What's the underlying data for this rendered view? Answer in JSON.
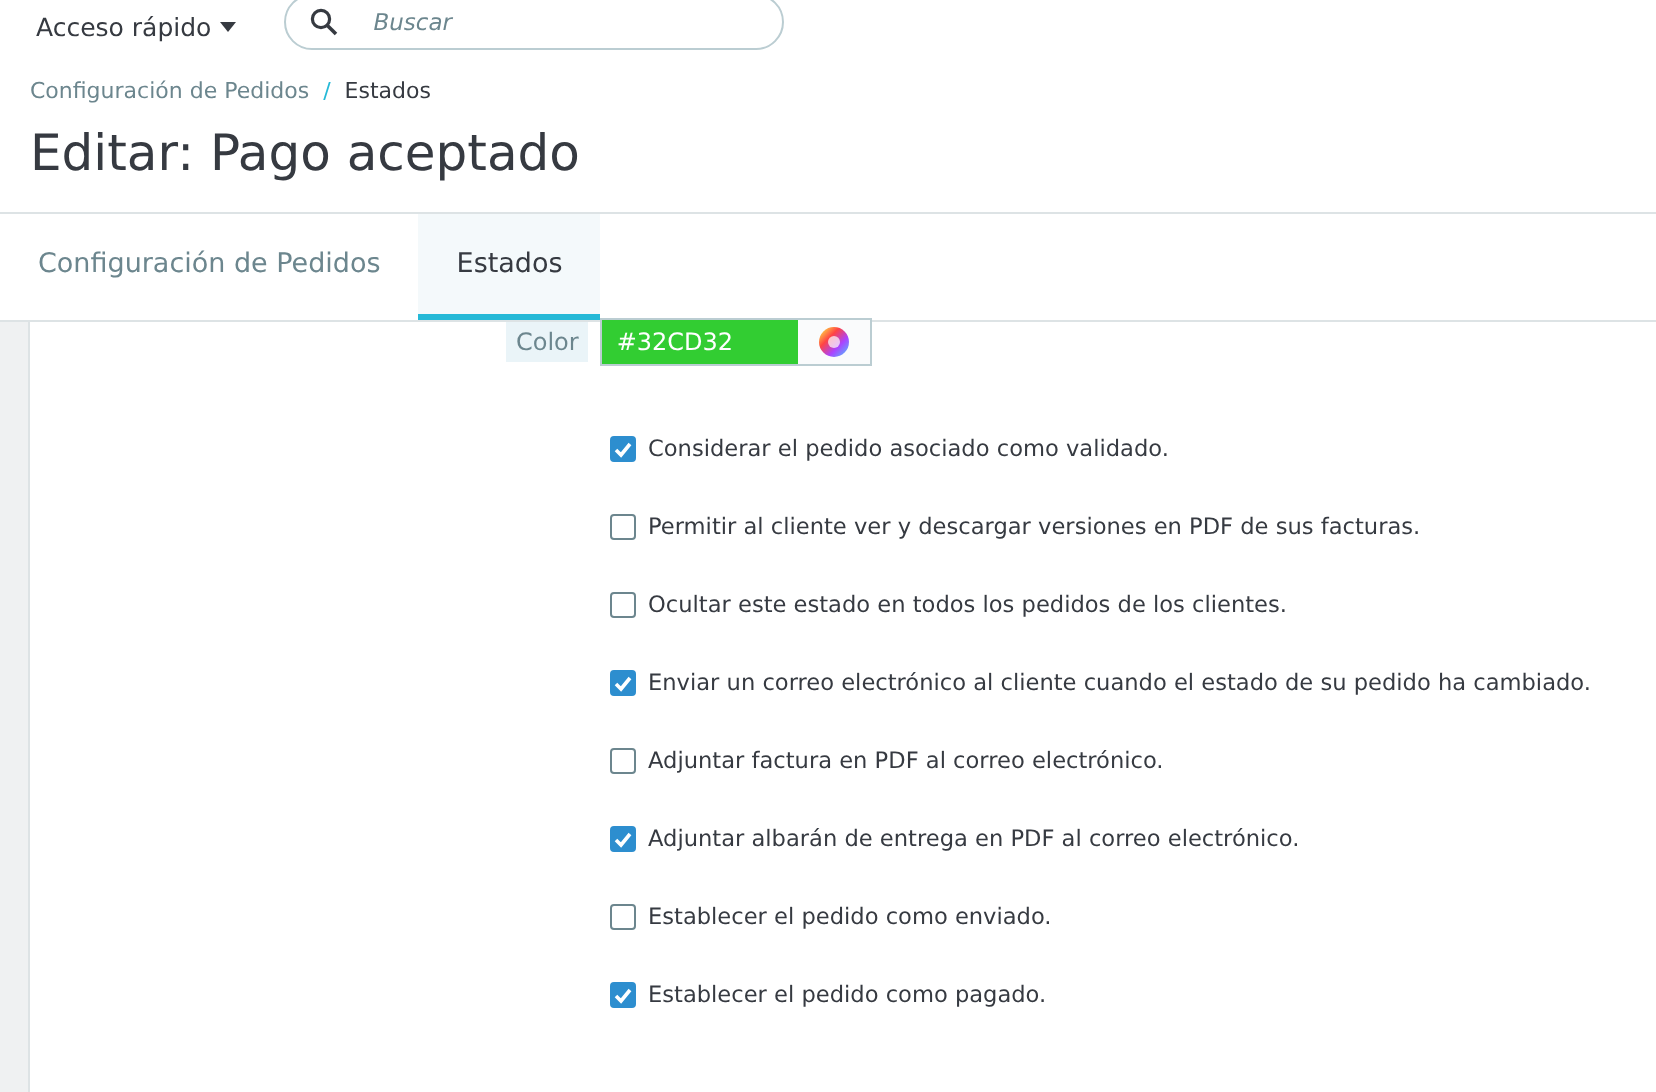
{
  "header": {
    "quick_access": "Acceso rápido",
    "search": {
      "placeholder": "Buscar"
    }
  },
  "breadcrumb_separator": "/",
  "breadcrumb": [
    {
      "label": "Configuración de Pedidos",
      "current": false
    },
    {
      "label": "Estados",
      "current": true
    }
  ],
  "title": "Editar: Pago aceptado",
  "tabs": [
    {
      "label": "Configuración de Pedidos",
      "selected": false
    },
    {
      "label": "Estados",
      "selected": true
    }
  ],
  "color_field": {
    "label": "Color",
    "value": "#32CD32",
    "color": "#32cd32"
  },
  "options": [
    {
      "label": "Considerar el pedido asociado como validado.",
      "checked": true
    },
    {
      "label": "Permitir al cliente ver y descargar versiones en PDF de sus facturas.",
      "checked": false
    },
    {
      "label": "Ocultar este estado en todos los pedidos de los clientes.",
      "checked": false
    },
    {
      "label": "Enviar un correo electrónico al cliente cuando el estado de su pedido ha cambiado.",
      "checked": true
    },
    {
      "label": "Adjuntar factura en PDF al correo electrónico.",
      "checked": false
    },
    {
      "label": "Adjuntar albarán de entrega en PDF al correo electrónico.",
      "checked": true
    },
    {
      "label": "Establecer el pedido como enviado.",
      "checked": false
    },
    {
      "label": "Establecer el pedido como pagado.",
      "checked": true
    }
  ]
}
